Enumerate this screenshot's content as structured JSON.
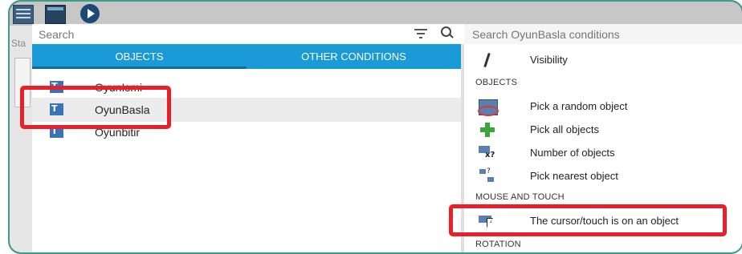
{
  "toolbar": {
    "icons": [
      "events-sheet-icon",
      "scene-editor-icon",
      "preview-play-icon"
    ]
  },
  "left_strip_text": "Sta",
  "search": {
    "objects_placeholder": "Search",
    "conditions_placeholder": "Search OyunBasla conditions"
  },
  "tabs": {
    "objects": "OBJECTS",
    "other_conditions": "OTHER CONDITIONS"
  },
  "objects": [
    {
      "label": "OyunIsmi",
      "selected": false
    },
    {
      "label": "OyunBasla",
      "selected": true
    },
    {
      "label": "Oyunbitir",
      "selected": false
    }
  ],
  "conditions": {
    "visibility": "Visibility",
    "sections": {
      "objects": "OBJECTS",
      "mouse_touch": "MOUSE AND TOUCH",
      "rotation": "ROTATION"
    },
    "objects_items": [
      "Pick a random object",
      "Pick all objects",
      "Number of objects",
      "Pick nearest object"
    ],
    "mouse_items": [
      "The cursor/touch is on an object"
    ]
  },
  "colors": {
    "tab_bar": "#1a9ad6",
    "highlight": "#e8202a",
    "frame_border": "#3f9c86"
  }
}
